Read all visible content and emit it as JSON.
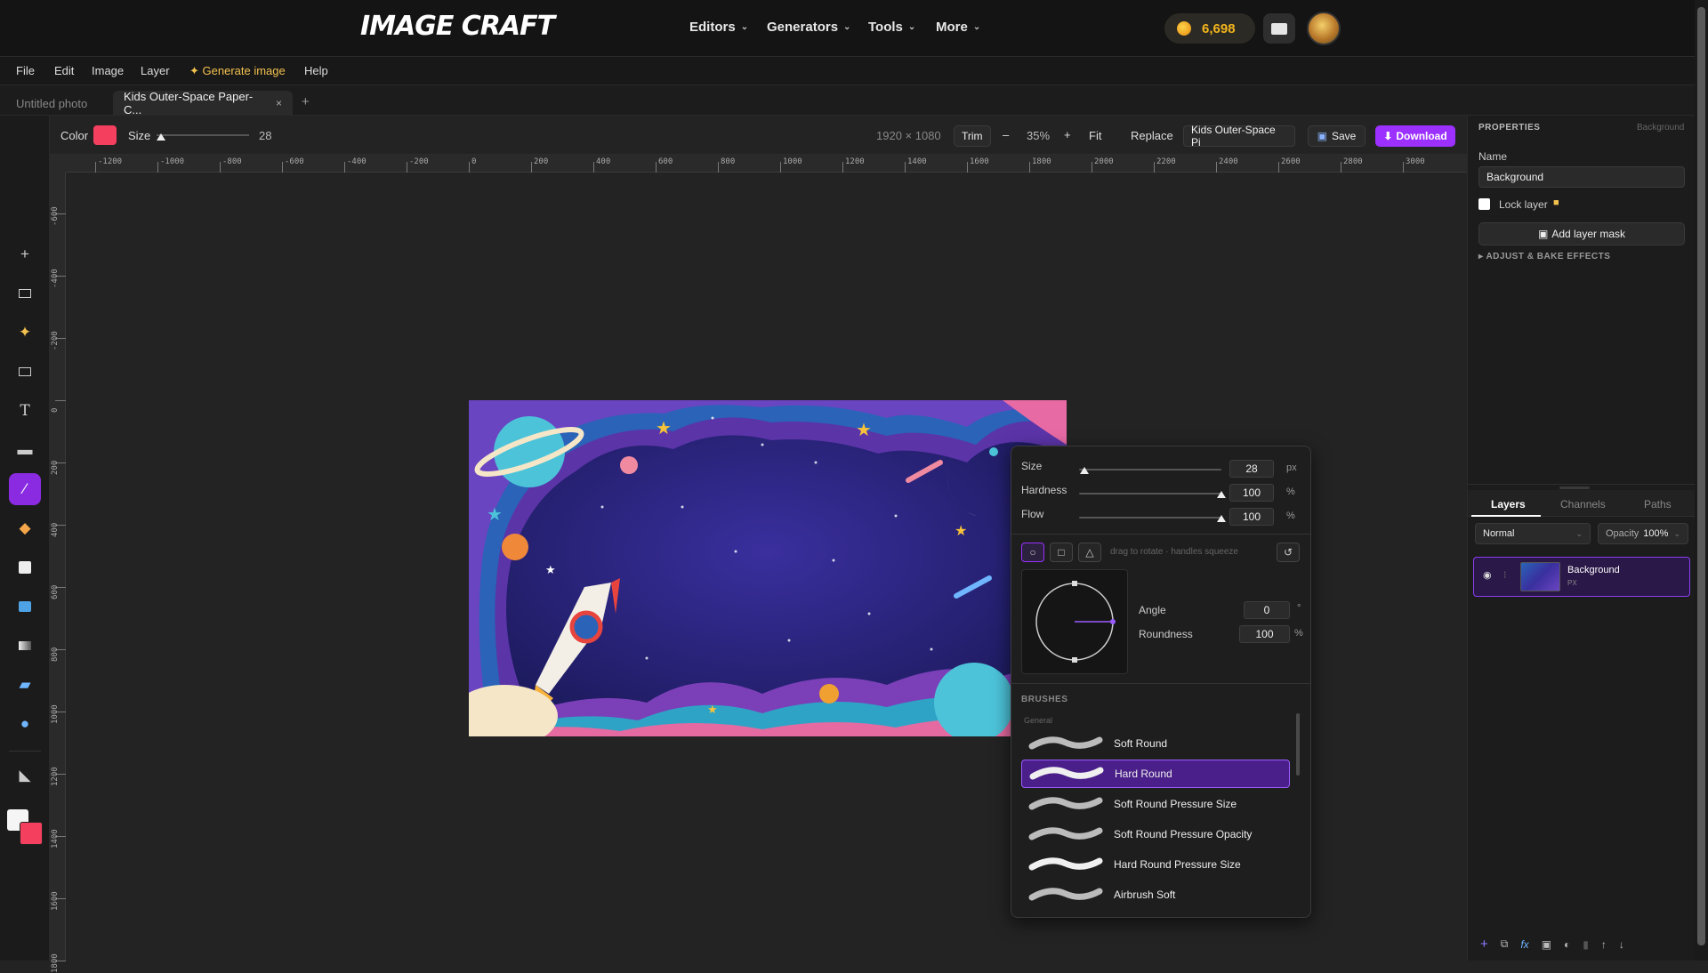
{
  "header": {
    "logo": "IMAGE CRAFT",
    "nav": [
      "Editors",
      "Generators",
      "Tools",
      "More"
    ],
    "coins": "6,698"
  },
  "menu": [
    "File",
    "Edit",
    "Image",
    "Layer",
    "Generate image",
    "Help"
  ],
  "tabs": {
    "items": [
      "Untitled photo",
      "Kids Outer-Space Paper-C..."
    ],
    "close": "×",
    "add": "+"
  },
  "options": {
    "color_label": "Color",
    "size_label": "Size",
    "size_value": "28",
    "dimensions": "1920 × 1080",
    "trim": "Trim",
    "zoom_minus": "–",
    "zoom": "35%",
    "zoom_plus": "+",
    "fit": "Fit",
    "replace": "Replace",
    "file_name": "Kids Outer-Space Pi",
    "save": "Save",
    "download": "Download",
    "brush_color": "#f43f5e"
  },
  "ruler": {
    "h": [
      "-1200",
      "-1000",
      "-800",
      "-600",
      "-400",
      "-200",
      "0",
      "200",
      "400",
      "600",
      "800",
      "1000",
      "1200",
      "1400",
      "1600",
      "1800",
      "2000",
      "2200",
      "2400",
      "2600",
      "2800",
      "3000"
    ],
    "v": [
      "-600",
      "-400",
      "-200",
      "0",
      "200",
      "400",
      "600",
      "800",
      "1000",
      "1200",
      "1400",
      "1600",
      "1800"
    ]
  },
  "properties": {
    "title": "PROPERTIES",
    "context": "Background",
    "name_label": "Name",
    "name_value": "Background",
    "lock_label": "Lock layer",
    "add_mask": "Add layer mask",
    "adjust": "ADJUST & BAKE EFFECTS"
  },
  "layers_panel": {
    "tabs": [
      "Layers",
      "Channels",
      "Paths"
    ],
    "blend_mode": "Normal",
    "opacity_label": "Opacity",
    "opacity_value": "100%",
    "layer_name": "Background",
    "layer_sub": "PX"
  },
  "brush_popup": {
    "size_label": "Size",
    "size_value": "28",
    "size_unit": "px",
    "hardness_label": "Hardness",
    "hardness_value": "100",
    "hardness_unit": "%",
    "flow_label": "Flow",
    "flow_value": "100",
    "flow_unit": "%",
    "hint": "drag to rotate · handles squeeze",
    "angle_label": "Angle",
    "angle_value": "0",
    "angle_unit": "°",
    "roundness_label": "Roundness",
    "roundness_value": "100",
    "roundness_unit": "%",
    "brushes_title": "BRUSHES",
    "group": "General",
    "brushes": [
      "Soft Round",
      "Hard Round",
      "Soft Round Pressure Size",
      "Soft Round Pressure Opacity",
      "Hard Round Pressure Size",
      "Airbrush Soft"
    ],
    "selected": "Hard Round",
    "size_level": 0.04,
    "hardness_level": 1.0,
    "flow_level": 1.0
  }
}
